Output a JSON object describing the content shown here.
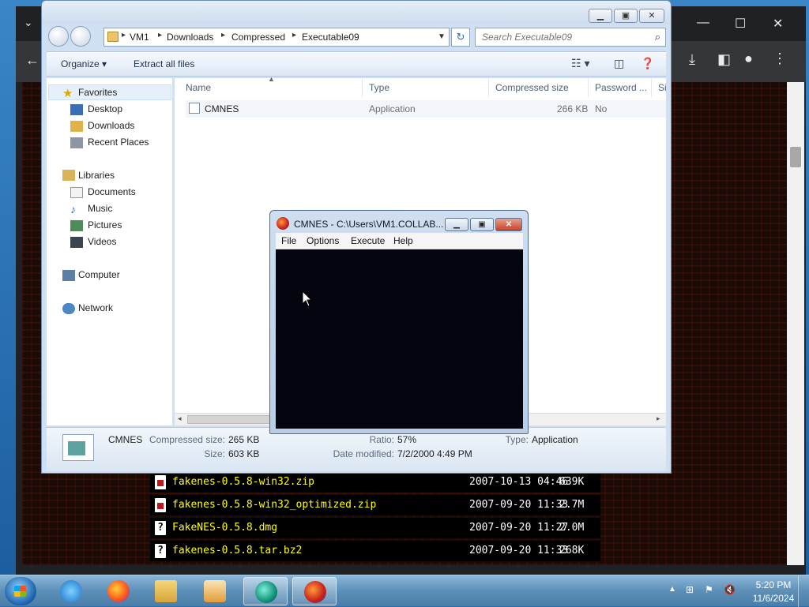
{
  "browser": {
    "files": [
      {
        "name": "fakenes-0.5.8-win32.zip",
        "date": "2007-10-13 04:46",
        "size": "639K",
        "icon": "zip"
      },
      {
        "name": "fakenes-0.5.8-win32_optimized.zip",
        "date": "2007-09-20 11:33",
        "size": "2.7M",
        "icon": "zip"
      },
      {
        "name": "FakeNES-0.5.8.dmg",
        "date": "2007-09-20 11:27",
        "size": "2.0M",
        "icon": "unknown"
      },
      {
        "name": "fakenes-0.5.8.tar.bz2",
        "date": "2007-09-20 11:33",
        "size": "268K",
        "icon": "unknown"
      }
    ]
  },
  "explorer": {
    "breadcrumb": [
      "VM1",
      "Downloads",
      "Compressed",
      "Executable09"
    ],
    "search_placeholder": "Search Executable09",
    "commands": {
      "organize": "Organize",
      "extract": "Extract all files"
    },
    "nav": {
      "favorites": "Favorites",
      "favorite_items": [
        "Desktop",
        "Downloads",
        "Recent Places"
      ],
      "libraries": "Libraries",
      "library_items": [
        "Documents",
        "Music",
        "Pictures",
        "Videos"
      ],
      "computer": "Computer",
      "network": "Network"
    },
    "columns": [
      "Name",
      "Type",
      "Compressed size",
      "Password ...",
      "Si"
    ],
    "rows": [
      {
        "name": "CMNES",
        "type": "Application",
        "compressed_size": "266 KB",
        "password": "No"
      }
    ],
    "details": {
      "name": "CMNES",
      "compressed_size_label": "Compressed size:",
      "compressed_size": "265 KB",
      "size_label": "Size:",
      "size": "603 KB",
      "ratio_label": "Ratio:",
      "ratio": "57%",
      "date_label": "Date modified:",
      "date": "7/2/2000 4:49 PM",
      "type_label": "Type:",
      "type": "Application"
    }
  },
  "cmnes": {
    "title": "CMNES - C:\\Users\\VM1.COLLAB...",
    "menu": [
      "File",
      "Options",
      "Execute",
      "Help"
    ]
  },
  "taskbar": {
    "time": "5:20 PM",
    "date": "11/6/2024"
  },
  "colors": {
    "accent": "#2c6bb0",
    "listing_text": "#ffff00",
    "emulator_screen": "#050510"
  }
}
